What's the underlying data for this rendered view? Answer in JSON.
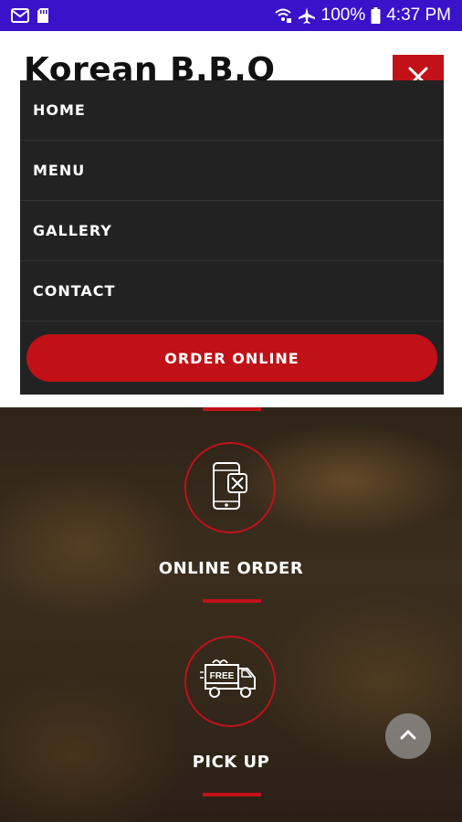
{
  "status_bar": {
    "battery_percent": "100%",
    "time": "4:37 PM",
    "icons": [
      "gmail-icon",
      "sd-card-icon",
      "wifi-icon",
      "airplane-mode-icon",
      "battery-icon"
    ]
  },
  "header": {
    "site_title": "Korean B.B.Q"
  },
  "menu": {
    "close_icon": "close-icon",
    "items": [
      "HOME",
      "MENU",
      "GALLERY",
      "CONTACT"
    ],
    "order_button": "ORDER ONLINE"
  },
  "features": [
    {
      "label": "ONLINE ORDER",
      "icon": "smartphone-food-icon"
    },
    {
      "label": "PICK UP",
      "icon": "free-delivery-truck-icon"
    }
  ],
  "scroll_top": {
    "icon": "chevron-up-icon"
  },
  "colors": {
    "status_bar": "#3a12c9",
    "accent_red": "#c1121a",
    "menu_bg": "#222222",
    "text_white": "#ffffff"
  }
}
